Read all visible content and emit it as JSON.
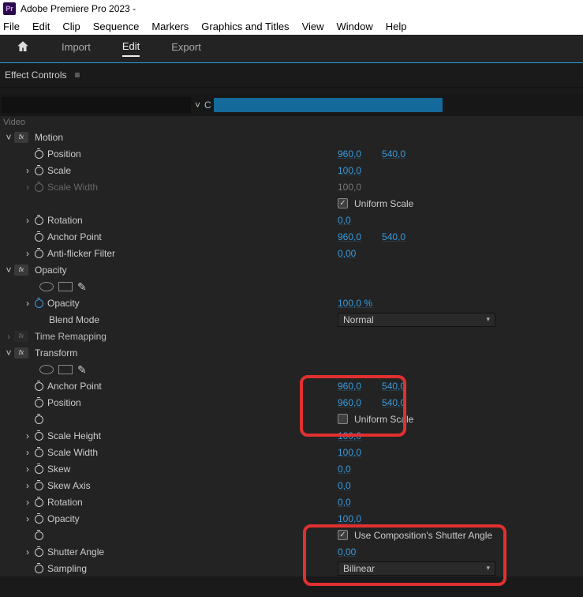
{
  "app_title": "Adobe Premiere Pro 2023 -",
  "app_icon_text": "Pr",
  "menubar": [
    "File",
    "Edit",
    "Clip",
    "Sequence",
    "Markers",
    "Graphics and Titles",
    "View",
    "Window",
    "Help"
  ],
  "topbar": {
    "tabs": [
      "Import",
      "Edit",
      "Export"
    ],
    "active": "Edit"
  },
  "panel_title": "Effect Controls",
  "video_label": "Video",
  "src_caret": "˅",
  "seq_prefix": "C",
  "motion": {
    "title": "Motion",
    "position": {
      "label": "Position",
      "x": "960,0",
      "y": "540,0"
    },
    "scale": {
      "label": "Scale",
      "v": "100,0"
    },
    "scale_width": {
      "label": "Scale Width",
      "v": "100,0"
    },
    "uniform": {
      "label": "Uniform Scale",
      "checked": true
    },
    "rotation": {
      "label": "Rotation",
      "v": "0,0"
    },
    "anchor": {
      "label": "Anchor Point",
      "x": "960,0",
      "y": "540,0"
    },
    "antiflicker": {
      "label": "Anti-flicker Filter",
      "v": "0,00"
    }
  },
  "opacity": {
    "title": "Opacity",
    "opacity": {
      "label": "Opacity",
      "v": "100,0 %"
    },
    "blend": {
      "label": "Blend Mode",
      "v": "Normal"
    }
  },
  "time_remapping": {
    "title": "Time Remapping"
  },
  "transform": {
    "title": "Transform",
    "anchor": {
      "label": "Anchor Point",
      "x": "960,0",
      "y": "540,0"
    },
    "position": {
      "label": "Position",
      "x": "960,0",
      "y": "540,0"
    },
    "uniform": {
      "label": "Uniform Scale",
      "checked": false
    },
    "scale_h": {
      "label": "Scale Height",
      "v": "100,0"
    },
    "scale_w": {
      "label": "Scale Width",
      "v": "100,0"
    },
    "skew": {
      "label": "Skew",
      "v": "0,0"
    },
    "skew_axis": {
      "label": "Skew Axis",
      "v": "0,0"
    },
    "rotation": {
      "label": "Rotation",
      "v": "0,0"
    },
    "opacity": {
      "label": "Opacity",
      "v": "100,0"
    },
    "use_comp": {
      "label": "Use Composition's Shutter Angle",
      "checked": true
    },
    "shutter": {
      "label": "Shutter Angle",
      "v": "0,00"
    },
    "sampling": {
      "label": "Sampling",
      "v": "Bilinear"
    }
  }
}
